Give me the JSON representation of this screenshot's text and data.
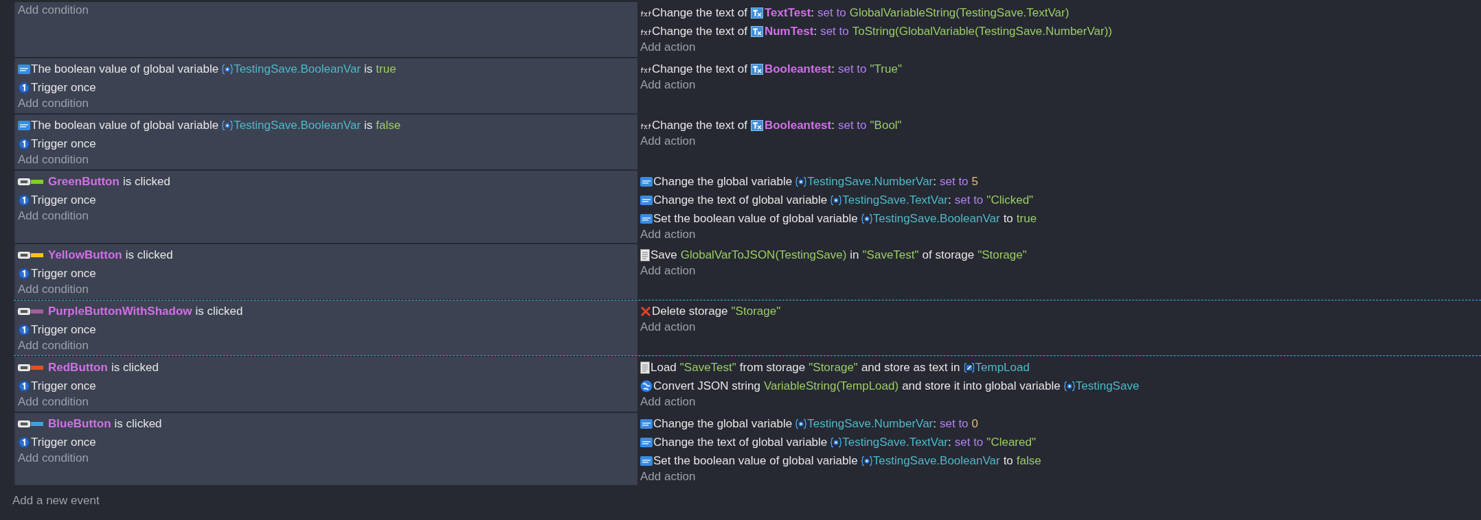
{
  "events": [
    {
      "selected": false,
      "add_condition": "Add condition",
      "actions": [
        {
          "kind": "txt",
          "parts": [
            {
              "kind": "text",
              "text": "Change the text of"
            },
            {
              "kind": "text-object",
              "text": "TextTest"
            },
            {
              "kind": "punct",
              "text": ":"
            },
            {
              "kind": "keyword",
              "text": "set to"
            },
            {
              "kind": "value",
              "text": "GlobalVariableString(TestingSave.TextVar)"
            }
          ]
        },
        {
          "kind": "txt",
          "parts": [
            {
              "kind": "text",
              "text": "Change the text of"
            },
            {
              "kind": "text-object",
              "text": "NumTest"
            },
            {
              "kind": "punct",
              "text": ":"
            },
            {
              "kind": "keyword",
              "text": "set to"
            },
            {
              "kind": "value",
              "text": "ToString(GlobalVariable(TestingSave.NumberVar))"
            }
          ]
        }
      ],
      "add_action": "Add action"
    },
    {
      "selected": false,
      "conditions": [
        {
          "kind": "var",
          "parts": [
            {
              "kind": "text",
              "text": "The boolean value of global variable"
            },
            {
              "kind": "variable",
              "text": "TestingSave.BooleanVar"
            },
            {
              "kind": "text",
              "text": "is"
            },
            {
              "kind": "value",
              "text": "true"
            }
          ]
        },
        {
          "kind": "trigger",
          "parts": [
            {
              "kind": "text",
              "text": "Trigger once"
            }
          ]
        }
      ],
      "add_condition": "Add condition",
      "actions": [
        {
          "kind": "txt",
          "parts": [
            {
              "kind": "text",
              "text": "Change the text of"
            },
            {
              "kind": "text-object",
              "text": "Booleantest"
            },
            {
              "kind": "punct",
              "text": ":"
            },
            {
              "kind": "keyword",
              "text": "set to"
            },
            {
              "kind": "value",
              "text": "\"True\""
            }
          ]
        }
      ],
      "add_action": "Add action"
    },
    {
      "selected": false,
      "conditions": [
        {
          "kind": "var",
          "parts": [
            {
              "kind": "text",
              "text": "The boolean value of global variable"
            },
            {
              "kind": "variable",
              "text": "TestingSave.BooleanVar"
            },
            {
              "kind": "text",
              "text": "is"
            },
            {
              "kind": "value",
              "text": "false"
            }
          ]
        },
        {
          "kind": "trigger",
          "parts": [
            {
              "kind": "text",
              "text": "Trigger once"
            }
          ]
        }
      ],
      "add_condition": "Add condition",
      "actions": [
        {
          "kind": "txt",
          "parts": [
            {
              "kind": "text",
              "text": "Change the text of"
            },
            {
              "kind": "text-object",
              "text": "Booleantest"
            },
            {
              "kind": "punct",
              "text": ":"
            },
            {
              "kind": "keyword",
              "text": "set to"
            },
            {
              "kind": "value",
              "text": "\"Bool\""
            }
          ]
        }
      ],
      "add_action": "Add action"
    },
    {
      "selected": false,
      "conditions": [
        {
          "kind": "button",
          "parts": [
            {
              "kind": "object",
              "color": "#7ed321",
              "text": "GreenButton"
            },
            {
              "kind": "text",
              "text": "is clicked"
            }
          ]
        },
        {
          "kind": "trigger",
          "parts": [
            {
              "kind": "text",
              "text": "Trigger once"
            }
          ]
        }
      ],
      "add_condition": "Add condition",
      "actions": [
        {
          "kind": "var",
          "parts": [
            {
              "kind": "text",
              "text": "Change the global variable"
            },
            {
              "kind": "variable",
              "text": "TestingSave.NumberVar"
            },
            {
              "kind": "punct",
              "text": ":"
            },
            {
              "kind": "keyword",
              "text": "set to"
            },
            {
              "kind": "number",
              "text": "5"
            }
          ]
        },
        {
          "kind": "var",
          "parts": [
            {
              "kind": "text",
              "text": "Change the text of global variable"
            },
            {
              "kind": "variable",
              "text": "TestingSave.TextVar"
            },
            {
              "kind": "punct",
              "text": ":"
            },
            {
              "kind": "keyword",
              "text": "set to"
            },
            {
              "kind": "value",
              "text": "\"Clicked\""
            }
          ]
        },
        {
          "kind": "var",
          "parts": [
            {
              "kind": "text",
              "text": "Set the boolean value of global variable"
            },
            {
              "kind": "variable",
              "text": "TestingSave.BooleanVar"
            },
            {
              "kind": "text",
              "text": "to"
            },
            {
              "kind": "value",
              "text": "true"
            }
          ]
        }
      ],
      "add_action": "Add action"
    },
    {
      "selected": false,
      "conditions": [
        {
          "kind": "button",
          "parts": [
            {
              "kind": "object",
              "color": "#f5c518",
              "text": "YellowButton"
            },
            {
              "kind": "text",
              "text": "is clicked"
            }
          ]
        },
        {
          "kind": "trigger",
          "parts": [
            {
              "kind": "text",
              "text": "Trigger once"
            }
          ]
        }
      ],
      "add_condition": "Add condition",
      "actions": [
        {
          "kind": "storage",
          "parts": [
            {
              "kind": "text",
              "text": "Save"
            },
            {
              "kind": "value",
              "text": "GlobalVarToJSON(TestingSave)"
            },
            {
              "kind": "text",
              "text": "in"
            },
            {
              "kind": "value",
              "text": "\"SaveTest\""
            },
            {
              "kind": "text",
              "text": "of storage"
            },
            {
              "kind": "value",
              "text": "\"Storage\""
            }
          ]
        }
      ],
      "add_action": "Add action"
    },
    {
      "selected": true,
      "conditions": [
        {
          "kind": "button",
          "parts": [
            {
              "kind": "object",
              "color": "#a0609a",
              "text": "PurpleButtonWithShadow"
            },
            {
              "kind": "text",
              "text": "is clicked"
            }
          ]
        },
        {
          "kind": "trigger",
          "parts": [
            {
              "kind": "text",
              "text": "Trigger once"
            }
          ]
        }
      ],
      "add_condition": "Add condition",
      "actions": [
        {
          "kind": "delete",
          "parts": [
            {
              "kind": "text",
              "text": "Delete storage"
            },
            {
              "kind": "value",
              "text": "\"Storage\""
            }
          ]
        }
      ],
      "add_action": "Add action"
    },
    {
      "selected": false,
      "conditions": [
        {
          "kind": "button",
          "parts": [
            {
              "kind": "object",
              "color": "#e0502a",
              "text": "RedButton"
            },
            {
              "kind": "text",
              "text": "is clicked"
            }
          ]
        },
        {
          "kind": "trigger",
          "parts": [
            {
              "kind": "text",
              "text": "Trigger once"
            }
          ]
        }
      ],
      "add_condition": "Add condition",
      "actions": [
        {
          "kind": "storage",
          "parts": [
            {
              "kind": "text",
              "text": "Load"
            },
            {
              "kind": "value",
              "text": "\"SaveTest\""
            },
            {
              "kind": "text",
              "text": "from storage"
            },
            {
              "kind": "value",
              "text": "\"Storage\""
            },
            {
              "kind": "text",
              "text": "and store as text in"
            },
            {
              "kind": "scene-variable",
              "text": "TempLoad"
            }
          ]
        },
        {
          "kind": "json",
          "parts": [
            {
              "kind": "text",
              "text": "Convert JSON string"
            },
            {
              "kind": "value",
              "text": "VariableString(TempLoad)"
            },
            {
              "kind": "text",
              "text": "and store it into global variable"
            },
            {
              "kind": "variable",
              "text": "TestingSave"
            }
          ]
        }
      ],
      "add_action": "Add action"
    },
    {
      "selected": false,
      "conditions": [
        {
          "kind": "button",
          "parts": [
            {
              "kind": "object",
              "color": "#3fa0e0",
              "text": "BlueButton"
            },
            {
              "kind": "text",
              "text": "is clicked"
            }
          ]
        },
        {
          "kind": "trigger",
          "parts": [
            {
              "kind": "text",
              "text": "Trigger once"
            }
          ]
        }
      ],
      "add_condition": "Add condition",
      "actions": [
        {
          "kind": "var",
          "parts": [
            {
              "kind": "text",
              "text": "Change the global variable"
            },
            {
              "kind": "variable",
              "text": "TestingSave.NumberVar"
            },
            {
              "kind": "punct",
              "text": ":"
            },
            {
              "kind": "keyword",
              "text": "set to"
            },
            {
              "kind": "number",
              "text": "0"
            }
          ]
        },
        {
          "kind": "var",
          "parts": [
            {
              "kind": "text",
              "text": "Change the text of global variable"
            },
            {
              "kind": "variable",
              "text": "TestingSave.TextVar"
            },
            {
              "kind": "punct",
              "text": ":"
            },
            {
              "kind": "keyword",
              "text": "set to"
            },
            {
              "kind": "value",
              "text": "\"Cleared\""
            }
          ]
        },
        {
          "kind": "var",
          "parts": [
            {
              "kind": "text",
              "text": "Set the boolean value of global variable"
            },
            {
              "kind": "variable",
              "text": "TestingSave.BooleanVar"
            },
            {
              "kind": "text",
              "text": "to"
            },
            {
              "kind": "value",
              "text": "false"
            }
          ]
        }
      ],
      "add_action": "Add action"
    }
  ],
  "add_event": "Add a new event"
}
